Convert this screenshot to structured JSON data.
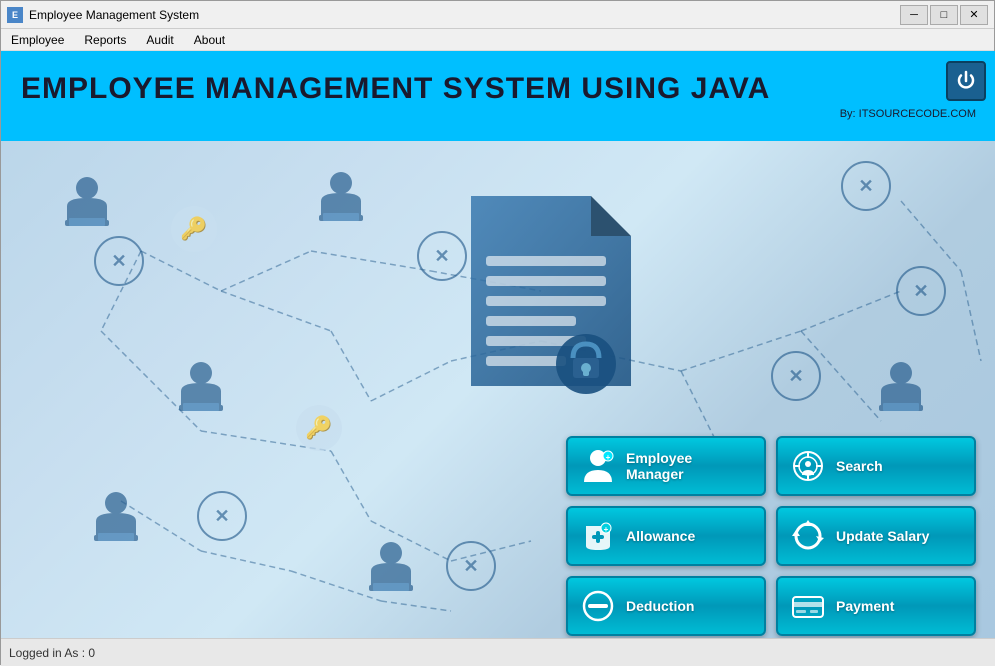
{
  "window": {
    "title": "Employee Management System",
    "icon": "E"
  },
  "titlebar": {
    "minimize_label": "─",
    "maximize_label": "□",
    "close_label": "✕"
  },
  "menubar": {
    "items": [
      {
        "label": "Employee",
        "id": "employee-menu"
      },
      {
        "label": "Reports",
        "id": "reports-menu"
      },
      {
        "label": "Audit",
        "id": "audit-menu"
      },
      {
        "label": "About",
        "id": "about-menu"
      }
    ]
  },
  "header": {
    "title": "EMPLOYEE MANAGEMENT SYSTEM USING JAVA",
    "subtitle": "By: ITSOURCECODE.COM"
  },
  "buttons": [
    {
      "id": "employee-manager",
      "label": "Employee Manager",
      "icon": "person"
    },
    {
      "id": "search",
      "label": "Search",
      "icon": "search"
    },
    {
      "id": "allowance",
      "label": "Allowance",
      "icon": "allowance"
    },
    {
      "id": "update-salary",
      "label": "Update Salary",
      "icon": "update"
    },
    {
      "id": "deduction",
      "label": "Deduction",
      "icon": "deduction"
    },
    {
      "id": "payment",
      "label": "Payment",
      "icon": "payment"
    }
  ],
  "statusbar": {
    "text": "Logged in As : 0"
  },
  "colors": {
    "header_bg": "#00bfff",
    "button_bg": "#00bcd4",
    "power_bg": "#1a6090",
    "node_color": "#2a6090"
  }
}
